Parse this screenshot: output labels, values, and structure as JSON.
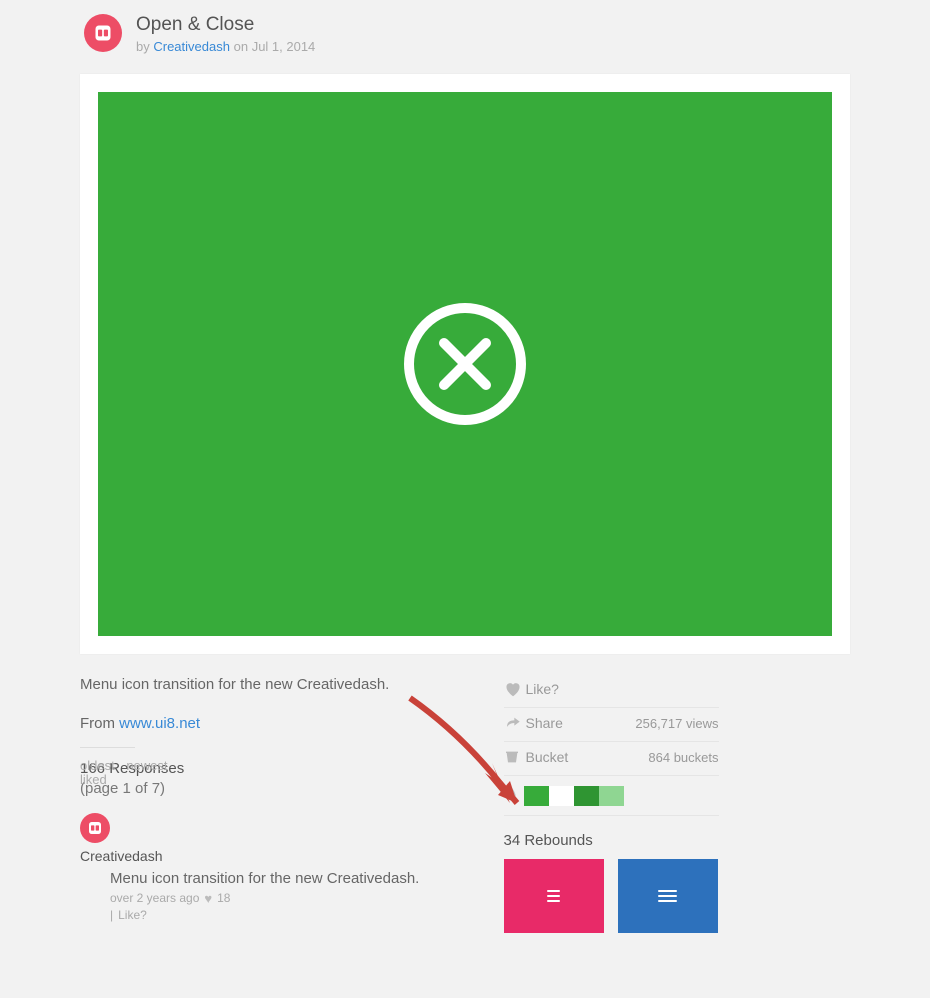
{
  "header": {
    "title": "Open & Close",
    "by_label": "by",
    "author": "Creativedash",
    "on_label": "on",
    "date": "Jul 1, 2014"
  },
  "description": "Menu icon transition for the new Creativedash.",
  "from_prefix": "From",
  "from_link": "www.ui8.net",
  "sort": {
    "oldest": "oldest",
    "newest": "newest",
    "liked": "liked"
  },
  "responses": {
    "count_line": "166 Responses",
    "pager": "(page 1 of 7)"
  },
  "comment": {
    "user": "Creativedash",
    "body": "Menu icon transition for the new Creativedash.",
    "time": "over 2 years ago",
    "likes": "18",
    "like_q": "Like?"
  },
  "actions": {
    "like": "Like?",
    "share": "Share",
    "bucket": "Bucket",
    "views_metric": "256,717 views",
    "buckets_metric": "864 buckets"
  },
  "swatches": [
    "#37ab3a",
    "#ffffff",
    "#2f9532",
    "#8fd692"
  ],
  "rebounds": {
    "title": "34 Rebounds"
  }
}
